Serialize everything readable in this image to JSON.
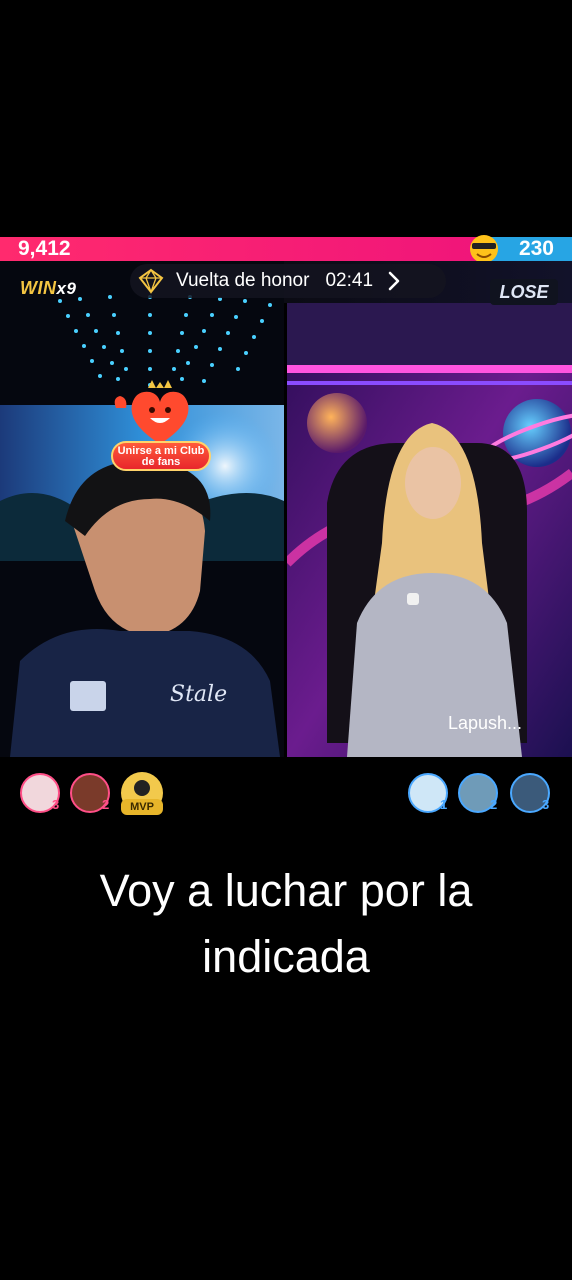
{
  "battle": {
    "left_score": "9,412",
    "right_score": "230",
    "win_label": "WIN",
    "win_multiplier": "x9",
    "lose_label": "LOSE",
    "honor_label": "Vuelta de honor",
    "honor_timer": "02:41"
  },
  "fan_club": {
    "label_line1": "Unirse a mi Club",
    "label_line2": "de fans"
  },
  "right_stream": {
    "name": "Lapush..."
  },
  "left_gifters": [
    {
      "rank": "3"
    },
    {
      "rank": "2"
    },
    {
      "badge": "MVP"
    }
  ],
  "right_gifters": [
    {
      "rank": "1"
    },
    {
      "rank": "2"
    },
    {
      "rank": "3"
    }
  ],
  "caption": {
    "line1": "Voy a luchar por la",
    "line2": "indicada"
  },
  "colors": {
    "left_bar": "#f0157a",
    "right_bar": "#27a5e4",
    "win_gold": "#f4c542"
  },
  "icons": [
    "cool-emoji-icon",
    "diamond-icon",
    "chevron-right-icon",
    "fan-heart-icon"
  ]
}
